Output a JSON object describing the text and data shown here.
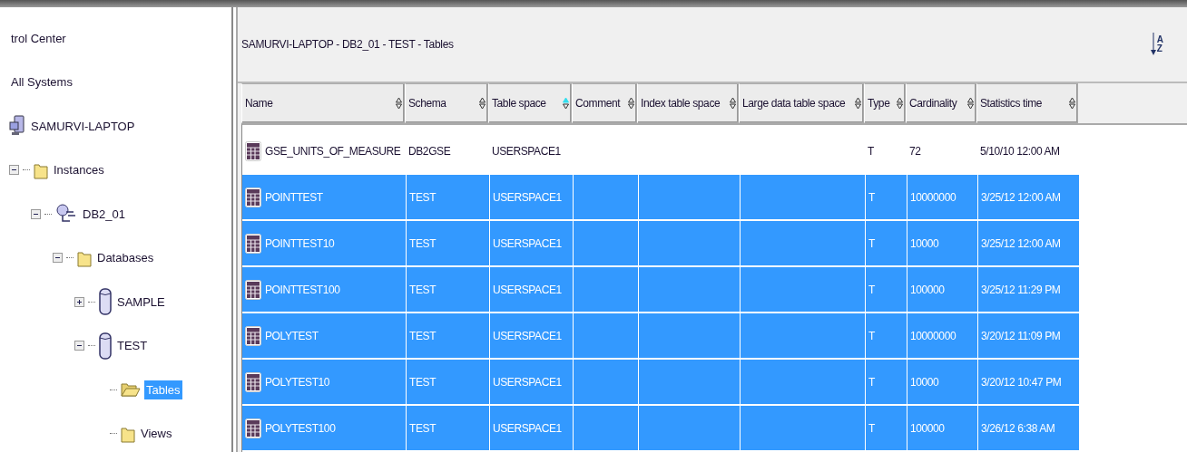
{
  "tree": [
    {
      "label": "trol Center",
      "kind": "label"
    },
    {
      "label": "All Systems",
      "kind": "label"
    },
    {
      "label": "SAMURVI-LAPTOP",
      "kind": "computer",
      "selected": false,
      "children": [
        {
          "label": "Instances",
          "kind": "folder",
          "expanded": true,
          "selected": false,
          "children": [
            {
              "label": "DB2_01",
              "kind": "instance",
              "expanded": true,
              "selected": false,
              "children": [
                {
                  "label": "Databases",
                  "kind": "folder",
                  "expanded": true,
                  "selected": false,
                  "children": [
                    {
                      "label": "SAMPLE",
                      "kind": "database",
                      "expanded": false,
                      "selected": false
                    },
                    {
                      "label": "TEST",
                      "kind": "database",
                      "expanded": true,
                      "selected": false,
                      "children": [
                        {
                          "label": "Tables",
                          "kind": "open-folder",
                          "selected": true
                        },
                        {
                          "label": "Views",
                          "kind": "folder",
                          "selected": false
                        }
                      ]
                    }
                  ]
                }
              ]
            }
          ]
        }
      ]
    }
  ],
  "panel": {
    "title": "SAMURVI-LAPTOP - DB2_01 - TEST - Tables",
    "sort_icon_letters": [
      "A",
      "Z"
    ]
  },
  "table": {
    "columns": [
      {
        "label": "Name",
        "sorted": false
      },
      {
        "label": "Schema",
        "sorted": false
      },
      {
        "label": "Table space",
        "sorted": true
      },
      {
        "label": "Comment",
        "sorted": false
      },
      {
        "label": "Index table space",
        "sorted": false
      },
      {
        "label": "Large data table space",
        "sorted": false
      },
      {
        "label": "Type",
        "sorted": false
      },
      {
        "label": "Cardinality",
        "sorted": false
      },
      {
        "label": "Statistics time",
        "sorted": false
      }
    ],
    "rows": [
      {
        "selected": false,
        "cells": [
          "GSE_UNITS_OF_MEASURE",
          "DB2GSE",
          "USERSPACE1",
          "",
          "",
          "",
          "T",
          "72",
          "5/10/10 12:00 AM"
        ]
      },
      {
        "selected": true,
        "cells": [
          "POINTTEST",
          "TEST",
          "USERSPACE1",
          "",
          "",
          "",
          "T",
          "10000000",
          "3/25/12 12:00 AM"
        ]
      },
      {
        "selected": true,
        "cells": [
          "POINTTEST10",
          "TEST",
          "USERSPACE1",
          "",
          "",
          "",
          "T",
          "10000",
          "3/25/12 12:00 AM"
        ]
      },
      {
        "selected": true,
        "cells": [
          "POINTTEST100",
          "TEST",
          "USERSPACE1",
          "",
          "",
          "",
          "T",
          "100000",
          "3/25/12 11:29 PM"
        ]
      },
      {
        "selected": true,
        "cells": [
          "POLYTEST",
          "TEST",
          "USERSPACE1",
          "",
          "",
          "",
          "T",
          "10000000",
          "3/20/12 11:09 PM"
        ]
      },
      {
        "selected": true,
        "cells": [
          "POLYTEST10",
          "TEST",
          "USERSPACE1",
          "",
          "",
          "",
          "T",
          "10000",
          "3/20/12 10:47 PM"
        ]
      },
      {
        "selected": true,
        "cells": [
          "POLYTEST100",
          "TEST",
          "USERSPACE1",
          "",
          "",
          "",
          "T",
          "100000",
          "3/26/12 6:38 AM"
        ]
      }
    ]
  }
}
